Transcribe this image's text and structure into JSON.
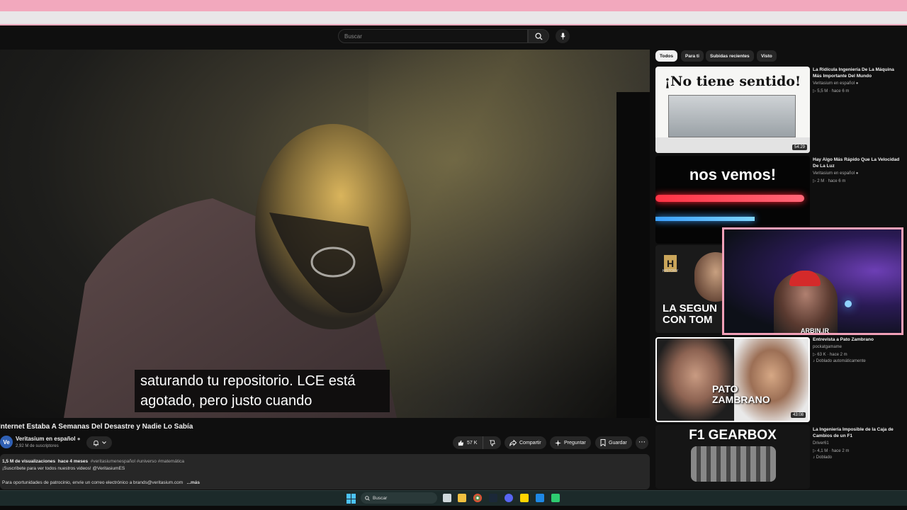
{
  "search": {
    "placeholder": "Buscar"
  },
  "video": {
    "subtitle_line1": "saturando tu repositorio. LCE está",
    "subtitle_line2": "agotado, pero justo cuando",
    "title": "Internet Estaba A Semanas Del Desastre y Nadie Lo Sabía",
    "channel_initials": "Ve",
    "channel": "Veritasium en español",
    "subscribers": "2,92 M de suscriptores",
    "likes": "57 K",
    "share_label": "Compartir",
    "ask_label": "Preguntar",
    "save_label": "Guardar",
    "views": "1,5 M de visualizaciones",
    "age": "hace 4 meses",
    "hashtags": "#veritasiumenespañol #universo #matemática",
    "desc_line1": "¡Suscríbete para ver todos nuestros videos! @VeritasiumES",
    "desc_line2": "Para oportunidades de patrocinio, envíe un correo electrónico a brands@veritasium.com",
    "more_label": "...más"
  },
  "chips": [
    "Todos",
    "Para ti",
    "Subidas recientes",
    "Visto"
  ],
  "recommendations": [
    {
      "thumb_text": "¡No tiene sentido!",
      "duration": "54:29",
      "title": "La Ridícula Ingeniería De La Máquina Más Importante Del Mundo",
      "channel": "Veritasium en español",
      "stats": "5,5 M · hace 6 m"
    },
    {
      "thumb_text": "nos vemos!",
      "title": "Hay Algo Más Rápido Que La Velocidad De La Luz",
      "channel": "Veritasium en español",
      "stats": "2 M · hace 6 m"
    },
    {
      "thumb_logo": "H",
      "thumb_brand": "HISTORY",
      "thumb_text_1": "LA SEGUN",
      "thumb_text_2": "CON TOM"
    },
    {
      "thumb_text_1": "PATO",
      "thumb_text_2": "ZAMBRANO",
      "duration": "43:08",
      "title": "Entrevista a Pato Zambrano",
      "channel": "pockatgamame",
      "stats": "63 K · hace 2 m",
      "badge": "Doblado automáticamente"
    },
    {
      "thumb_text": "F1 GEARBOX",
      "title": "La Ingeniería Imposible de la Caja de Cambios de un F1",
      "channel": "Driver61",
      "stats": "4,1 M · hace 2 m",
      "badge": "Doblado"
    }
  ],
  "webcam": {
    "tag": "ARBIN.IR"
  },
  "taskbar": {
    "search_label": "Buscar"
  },
  "colors": {
    "accent_pink": "#f2a8bd",
    "yt_bg": "#0f0f0f",
    "chip_active": "#f1f1f1"
  }
}
